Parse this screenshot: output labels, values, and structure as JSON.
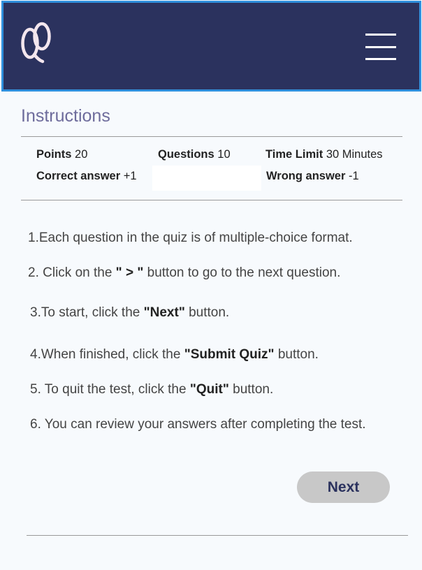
{
  "header": {
    "logo_icon": "quiz-logo-icon",
    "menu_icon": "hamburger-menu-icon",
    "bg_color": "#2b325e",
    "border_color": "#2f8fdc"
  },
  "page": {
    "title": "Instructions"
  },
  "info": {
    "points_label": "Points",
    "points_value": "20",
    "questions_label": "Questions",
    "questions_value": "10",
    "time_label": "Time Limit",
    "time_value": "30 Minutes",
    "correct_label": "Correct answer",
    "correct_value": "+1",
    "wrong_label": "Wrong answer",
    "wrong_value": "-1"
  },
  "steps": [
    {
      "pre": "1.Each question in the quiz is of multiple-choice format.",
      "bold": "",
      "post": ""
    },
    {
      "pre": "2. Click on the ",
      "bold": "\" > \"",
      "post": " button to go to the next question."
    },
    {
      "pre": "3.To start, click the ",
      "bold": "\"Next\"",
      "post": " button."
    },
    {
      "pre": "4.When finished, click the ",
      "bold": "\"Submit Quiz\"",
      "post": " button."
    },
    {
      "pre": "5. To quit the test, click the ",
      "bold": "\"Quit\"",
      "post": " button."
    },
    {
      "pre": "6. You can review your answers after completing  the test.",
      "bold": "",
      "post": ""
    }
  ],
  "actions": {
    "next_label": "Next"
  }
}
